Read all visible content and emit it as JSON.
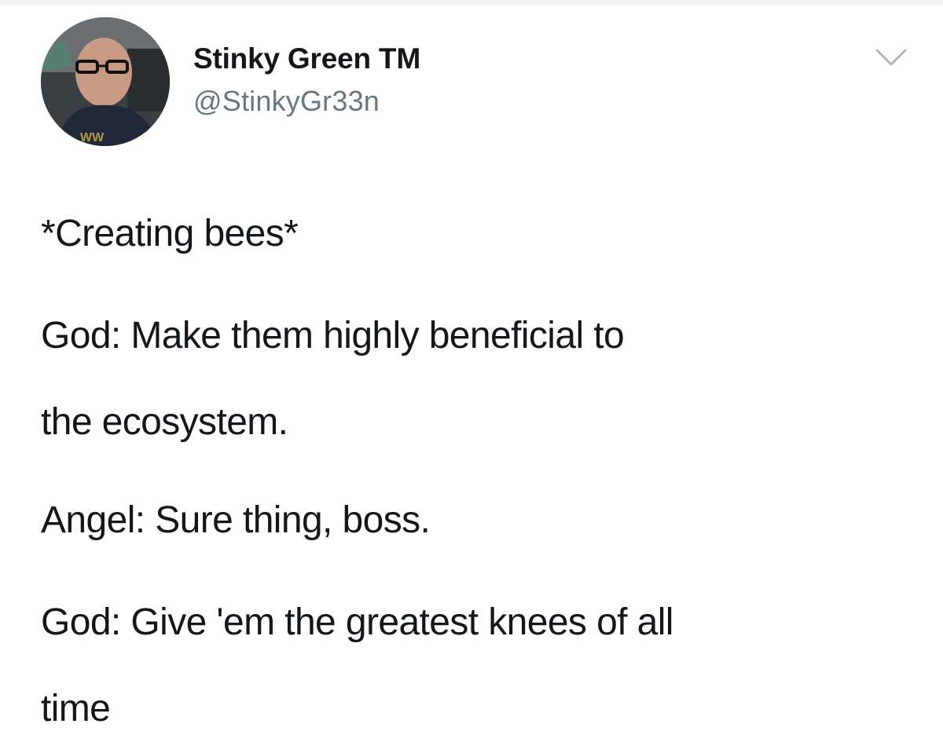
{
  "tweet": {
    "display_name": "Stinky Green",
    "name_suffix": "TM",
    "handle": "@StinkyGr33n",
    "lines": [
      "*Creating bees*",
      "God: Make them highly beneficial to",
      "the ecosystem.",
      "Angel: Sure thing, boss.",
      "God: Give 'em the greatest knees of all",
      "time"
    ]
  },
  "icons": {
    "menu": "chevron-down-icon",
    "avatar": "avatar"
  },
  "colors": {
    "text": "#14171a",
    "secondary": "#657786",
    "background": "#ffffff"
  }
}
